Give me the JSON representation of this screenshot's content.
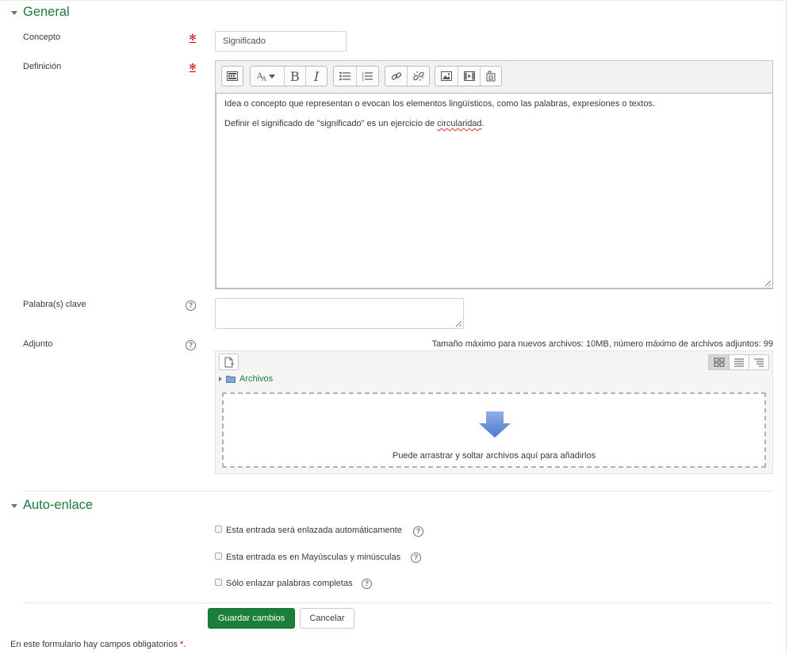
{
  "sections": {
    "general": {
      "title": "General"
    },
    "autolink": {
      "title": "Auto-enlace"
    }
  },
  "fields": {
    "concept": {
      "label": "Concepto",
      "value": "Significado"
    },
    "definition": {
      "label": "Definición",
      "paragraph1": "Idea o concepto que representan o evocan los elementos lingüísticos, como las palabras, expresiones o textos.",
      "paragraph2_before": "Definir el significado de \"significado\" es un ejercicio de ",
      "paragraph2_misspelled": "circularidad",
      "paragraph2_after": "."
    },
    "keywords": {
      "label": "Palabra(s) clave",
      "value": ""
    },
    "attachment": {
      "label": "Adjunto",
      "limits": "Tamaño máximo para nuevos archivos: 10MB, número máximo de archivos adjuntos: 99",
      "folder": "Archivos",
      "drop_text": "Puede arrastrar y soltar archivos aquí para añadirlos"
    }
  },
  "toolbar": {
    "buttons": [
      "toolbar-toggle-icon",
      "font-style-icon",
      "bold-icon",
      "italic-icon",
      "unordered-list-icon",
      "ordered-list-icon",
      "link-icon",
      "unlink-icon",
      "image-icon",
      "media-icon",
      "manage-files-icon"
    ],
    "bold_glyph": "B",
    "italic_glyph": "I"
  },
  "autolink": {
    "options": [
      {
        "label": "Esta entrada será enlazada automáticamente",
        "checked": false
      },
      {
        "label": "Esta entrada es en Mayúsculas y minúsculas",
        "checked": false
      },
      {
        "label": "Sólo enlazar palabras completas",
        "checked": false
      }
    ]
  },
  "actions": {
    "save": "Guardar cambios",
    "cancel": "Cancelar"
  },
  "footer": {
    "required_note": "En este formulario hay campos obligatorios",
    "required_star": "*",
    "period": "."
  },
  "colors": {
    "section_title": "#1f7a3e",
    "primary_button": "#1b7f3a",
    "required": "#cc0000"
  }
}
